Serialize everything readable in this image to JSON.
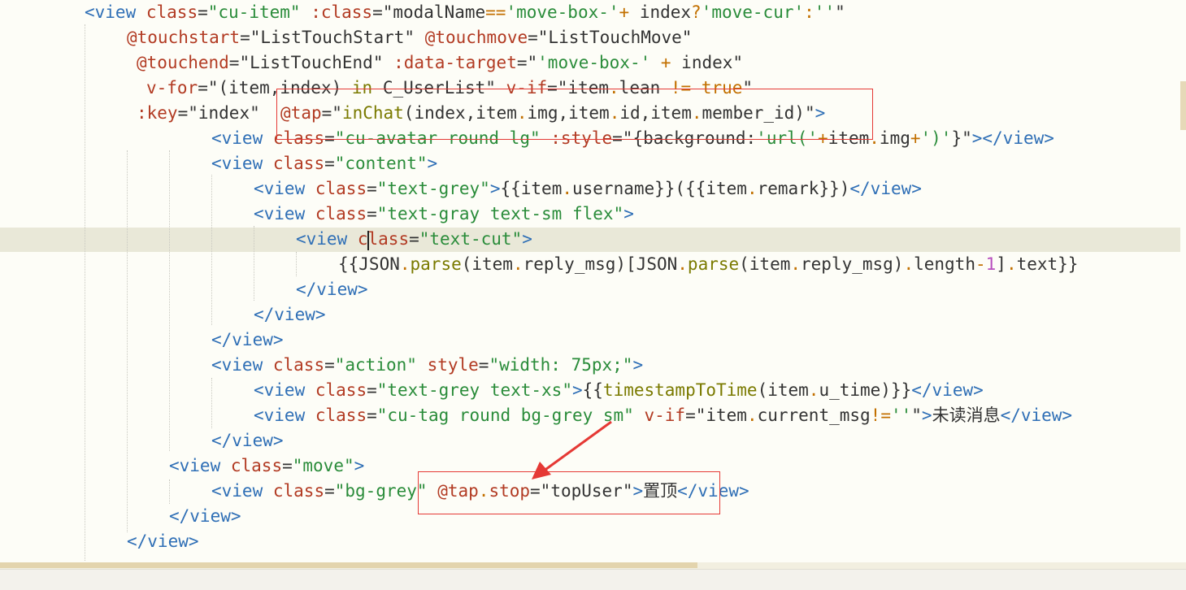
{
  "code_lines": [
    {
      "tokens": [
        {
          "t": "<view",
          "c": "tag"
        },
        {
          "t": " ",
          "c": "txt"
        },
        {
          "t": "class",
          "c": "attr"
        },
        {
          "t": "=",
          "c": "txt"
        },
        {
          "t": "\"cu-item\"",
          "c": "str"
        },
        {
          "t": " ",
          "c": "txt"
        },
        {
          "t": ":class",
          "c": "attr"
        },
        {
          "t": "=",
          "c": "txt"
        },
        {
          "t": "\"modalName",
          "c": "txt"
        },
        {
          "t": "==",
          "c": "op"
        },
        {
          "t": "'move-box-'",
          "c": "str"
        },
        {
          "t": "+",
          "c": "op"
        },
        {
          "t": " index",
          "c": "txt"
        },
        {
          "t": "?",
          "c": "op"
        },
        {
          "t": "'move-cur'",
          "c": "str"
        },
        {
          "t": ":",
          "c": "op"
        },
        {
          "t": "''",
          "c": "str"
        },
        {
          "t": "\"",
          "c": "txt"
        }
      ]
    },
    {
      "tokens": [
        {
          "t": "@touchstart",
          "c": "attr"
        },
        {
          "t": "=",
          "c": "txt"
        },
        {
          "t": "\"ListTouchStart\"",
          "c": "txt"
        },
        {
          "t": " ",
          "c": "txt"
        },
        {
          "t": "@touchmove",
          "c": "attr"
        },
        {
          "t": "=",
          "c": "txt"
        },
        {
          "t": "\"ListTouchMove\"",
          "c": "txt"
        }
      ]
    },
    {
      "tokens": [
        {
          "t": "@touchend",
          "c": "attr"
        },
        {
          "t": "=",
          "c": "txt"
        },
        {
          "t": "\"ListTouchEnd\"",
          "c": "txt"
        },
        {
          "t": " ",
          "c": "txt"
        },
        {
          "t": ":data-target",
          "c": "attr"
        },
        {
          "t": "=",
          "c": "txt"
        },
        {
          "t": "\"",
          "c": "txt"
        },
        {
          "t": "'move-box-'",
          "c": "str"
        },
        {
          "t": " + ",
          "c": "op"
        },
        {
          "t": "index\"",
          "c": "txt"
        }
      ]
    },
    {
      "tokens": [
        {
          "t": "v-for",
          "c": "attr"
        },
        {
          "t": "=",
          "c": "txt"
        },
        {
          "t": "\"(item,index) ",
          "c": "txt"
        },
        {
          "t": "in",
          "c": "kw"
        },
        {
          "t": " C_UserList\"",
          "c": "txt"
        },
        {
          "t": " ",
          "c": "txt"
        },
        {
          "t": "v-if",
          "c": "attr"
        },
        {
          "t": "=",
          "c": "txt"
        },
        {
          "t": "\"item",
          "c": "txt"
        },
        {
          "t": ".",
          "c": "op"
        },
        {
          "t": "lean ",
          "c": "txt"
        },
        {
          "t": "!=",
          "c": "op"
        },
        {
          "t": " ",
          "c": "txt"
        },
        {
          "t": "true",
          "c": "op"
        },
        {
          "t": "\"",
          "c": "txt"
        }
      ]
    },
    {
      "tokens": [
        {
          "t": ":key",
          "c": "attr"
        },
        {
          "t": "=",
          "c": "txt"
        },
        {
          "t": "\"index\"",
          "c": "txt"
        },
        {
          "t": "  ",
          "c": "txt"
        },
        {
          "t": "@tap",
          "c": "attr"
        },
        {
          "t": "=",
          "c": "txt"
        },
        {
          "t": "\"",
          "c": "txt"
        },
        {
          "t": "inChat",
          "c": "fn"
        },
        {
          "t": "(index,item",
          "c": "txt"
        },
        {
          "t": ".",
          "c": "op"
        },
        {
          "t": "img,item",
          "c": "txt"
        },
        {
          "t": ".",
          "c": "op"
        },
        {
          "t": "id,item",
          "c": "txt"
        },
        {
          "t": ".",
          "c": "op"
        },
        {
          "t": "member_id)\"",
          "c": "txt"
        },
        {
          "t": ">",
          "c": "tag"
        }
      ]
    },
    {
      "tokens": [
        {
          "t": "<view",
          "c": "tag"
        },
        {
          "t": " ",
          "c": "txt"
        },
        {
          "t": "class",
          "c": "attr"
        },
        {
          "t": "=",
          "c": "txt"
        },
        {
          "t": "\"cu-avatar round lg\"",
          "c": "str"
        },
        {
          "t": " ",
          "c": "txt"
        },
        {
          "t": ":style",
          "c": "attr"
        },
        {
          "t": "=",
          "c": "txt"
        },
        {
          "t": "\"{background:",
          "c": "txt"
        },
        {
          "t": "'url('",
          "c": "str"
        },
        {
          "t": "+",
          "c": "op"
        },
        {
          "t": "item",
          "c": "txt"
        },
        {
          "t": ".",
          "c": "op"
        },
        {
          "t": "img",
          "c": "txt"
        },
        {
          "t": "+",
          "c": "op"
        },
        {
          "t": "')'",
          "c": "str"
        },
        {
          "t": "}\"",
          "c": "txt"
        },
        {
          "t": "></view>",
          "c": "tag"
        }
      ]
    },
    {
      "tokens": [
        {
          "t": "<view",
          "c": "tag"
        },
        {
          "t": " ",
          "c": "txt"
        },
        {
          "t": "class",
          "c": "attr"
        },
        {
          "t": "=",
          "c": "txt"
        },
        {
          "t": "\"content\"",
          "c": "str"
        },
        {
          "t": ">",
          "c": "tag"
        }
      ]
    },
    {
      "tokens": [
        {
          "t": "<view",
          "c": "tag"
        },
        {
          "t": " ",
          "c": "txt"
        },
        {
          "t": "class",
          "c": "attr"
        },
        {
          "t": "=",
          "c": "txt"
        },
        {
          "t": "\"text-grey\"",
          "c": "str"
        },
        {
          "t": ">",
          "c": "tag"
        },
        {
          "t": "{{item",
          "c": "txt"
        },
        {
          "t": ".",
          "c": "op"
        },
        {
          "t": "username}}({{item",
          "c": "txt"
        },
        {
          "t": ".",
          "c": "op"
        },
        {
          "t": "remark}})",
          "c": "txt"
        },
        {
          "t": "</view>",
          "c": "tag"
        }
      ]
    },
    {
      "tokens": [
        {
          "t": "<view",
          "c": "tag"
        },
        {
          "t": " ",
          "c": "txt"
        },
        {
          "t": "class",
          "c": "attr"
        },
        {
          "t": "=",
          "c": "txt"
        },
        {
          "t": "\"text-gray text-sm flex\"",
          "c": "str"
        },
        {
          "t": ">",
          "c": "tag"
        }
      ]
    },
    {
      "tokens": [
        {
          "t": "<view",
          "c": "tag"
        },
        {
          "t": " ",
          "c": "txt"
        },
        {
          "t": "class",
          "c": "attr"
        },
        {
          "t": "=",
          "c": "txt"
        },
        {
          "t": "\"text-cut\"",
          "c": "str"
        },
        {
          "t": ">",
          "c": "tag"
        }
      ]
    },
    {
      "tokens": [
        {
          "t": "{{JSON",
          "c": "txt"
        },
        {
          "t": ".",
          "c": "op"
        },
        {
          "t": "parse",
          "c": "fn"
        },
        {
          "t": "(item",
          "c": "txt"
        },
        {
          "t": ".",
          "c": "op"
        },
        {
          "t": "reply_msg)[JSON",
          "c": "txt"
        },
        {
          "t": ".",
          "c": "op"
        },
        {
          "t": "parse",
          "c": "fn"
        },
        {
          "t": "(item",
          "c": "txt"
        },
        {
          "t": ".",
          "c": "op"
        },
        {
          "t": "reply_msg)",
          "c": "txt"
        },
        {
          "t": ".",
          "c": "op"
        },
        {
          "t": "length",
          "c": "txt"
        },
        {
          "t": "-",
          "c": "op"
        },
        {
          "t": "1",
          "c": "num"
        },
        {
          "t": "]",
          "c": "txt"
        },
        {
          "t": ".",
          "c": "op"
        },
        {
          "t": "text}}",
          "c": "txt"
        }
      ]
    },
    {
      "tokens": [
        {
          "t": "</view>",
          "c": "tag"
        }
      ]
    },
    {
      "tokens": [
        {
          "t": "</view>",
          "c": "tag"
        }
      ]
    },
    {
      "tokens": [
        {
          "t": "</view>",
          "c": "tag"
        }
      ]
    },
    {
      "tokens": [
        {
          "t": "<view",
          "c": "tag"
        },
        {
          "t": " ",
          "c": "txt"
        },
        {
          "t": "class",
          "c": "attr"
        },
        {
          "t": "=",
          "c": "txt"
        },
        {
          "t": "\"action\"",
          "c": "str"
        },
        {
          "t": " ",
          "c": "txt"
        },
        {
          "t": "style",
          "c": "attr"
        },
        {
          "t": "=",
          "c": "txt"
        },
        {
          "t": "\"width: 75px;\"",
          "c": "str"
        },
        {
          "t": ">",
          "c": "tag"
        }
      ]
    },
    {
      "tokens": [
        {
          "t": "<view",
          "c": "tag"
        },
        {
          "t": " ",
          "c": "txt"
        },
        {
          "t": "class",
          "c": "attr"
        },
        {
          "t": "=",
          "c": "txt"
        },
        {
          "t": "\"text-grey text-xs\"",
          "c": "str"
        },
        {
          "t": ">",
          "c": "tag"
        },
        {
          "t": "{{",
          "c": "txt"
        },
        {
          "t": "timestampToTime",
          "c": "fn"
        },
        {
          "t": "(item",
          "c": "txt"
        },
        {
          "t": ".",
          "c": "op"
        },
        {
          "t": "u_time)}}",
          "c": "txt"
        },
        {
          "t": "</view>",
          "c": "tag"
        }
      ]
    },
    {
      "tokens": [
        {
          "t": "<view",
          "c": "tag"
        },
        {
          "t": " ",
          "c": "txt"
        },
        {
          "t": "class",
          "c": "attr"
        },
        {
          "t": "=",
          "c": "txt"
        },
        {
          "t": "\"cu-tag round bg-grey sm\"",
          "c": "str"
        },
        {
          "t": " ",
          "c": "txt"
        },
        {
          "t": "v-if",
          "c": "attr"
        },
        {
          "t": "=",
          "c": "txt"
        },
        {
          "t": "\"item",
          "c": "txt"
        },
        {
          "t": ".",
          "c": "op"
        },
        {
          "t": "current_msg",
          "c": "txt"
        },
        {
          "t": "!=",
          "c": "op"
        },
        {
          "t": "''",
          "c": "str"
        },
        {
          "t": "\"",
          "c": "txt"
        },
        {
          "t": ">",
          "c": "tag"
        },
        {
          "t": "未读消息",
          "c": "txt"
        },
        {
          "t": "</view>",
          "c": "tag"
        }
      ]
    },
    {
      "tokens": [
        {
          "t": "</view>",
          "c": "tag"
        }
      ]
    },
    {
      "tokens": [
        {
          "t": "<view",
          "c": "tag"
        },
        {
          "t": " ",
          "c": "txt"
        },
        {
          "t": "class",
          "c": "attr"
        },
        {
          "t": "=",
          "c": "txt"
        },
        {
          "t": "\"move\"",
          "c": "str"
        },
        {
          "t": ">",
          "c": "tag"
        }
      ]
    },
    {
      "tokens": [
        {
          "t": "<view",
          "c": "tag"
        },
        {
          "t": " ",
          "c": "txt"
        },
        {
          "t": "class",
          "c": "attr"
        },
        {
          "t": "=",
          "c": "txt"
        },
        {
          "t": "\"bg-grey\"",
          "c": "str"
        },
        {
          "t": " ",
          "c": "txt"
        },
        {
          "t": "@tap",
          "c": "attr"
        },
        {
          "t": ".",
          "c": "op"
        },
        {
          "t": "stop",
          "c": "attr"
        },
        {
          "t": "=",
          "c": "txt"
        },
        {
          "t": "\"topUser\"",
          "c": "txt"
        },
        {
          "t": ">",
          "c": "tag"
        },
        {
          "t": "置顶",
          "c": "txt"
        },
        {
          "t": "</view>",
          "c": "tag"
        }
      ]
    },
    {
      "tokens": [
        {
          "t": "</view>",
          "c": "tag"
        }
      ]
    },
    {
      "tokens": [
        {
          "t": "</view>",
          "c": "tag"
        }
      ]
    }
  ],
  "colors": {
    "background": "#fdfdf7",
    "tag": "#2f6fb6",
    "attribute": "#b23b23",
    "string": "#2a8c3a",
    "operator": "#c27000",
    "function": "#7a7a00",
    "number": "#b84fbe",
    "annotation": "#e53935",
    "current_line": "#e9e8d8"
  }
}
